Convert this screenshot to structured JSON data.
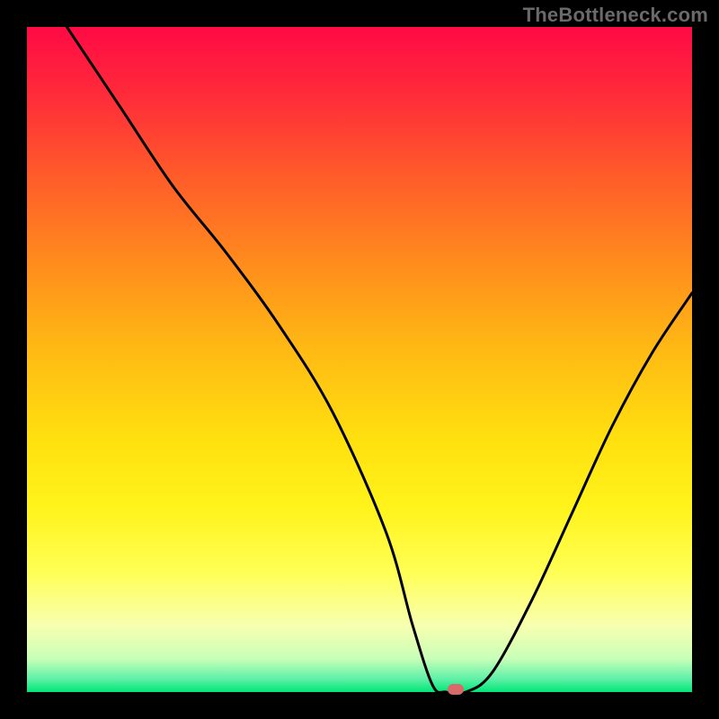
{
  "attribution": "TheBottleneck.com",
  "chart_data": {
    "type": "line",
    "title": "",
    "xlabel": "",
    "ylabel": "",
    "xlim": [
      0,
      100
    ],
    "ylim": [
      0,
      100
    ],
    "series": [
      {
        "name": "curve",
        "x": [
          6,
          14,
          22,
          30,
          38,
          46,
          54,
          58,
          61,
          63,
          66,
          70,
          76,
          82,
          88,
          94,
          100
        ],
        "y": [
          100,
          88,
          76,
          66,
          55,
          42,
          24,
          10,
          1,
          0,
          0,
          3,
          14,
          27,
          40,
          51,
          60
        ]
      }
    ],
    "marker": {
      "x": 64.5,
      "y": 0
    },
    "colors": {
      "curve": "#000000",
      "marker": "#d86a6a",
      "frame": "#000000",
      "gradient_top": "#ff0a45",
      "gradient_bottom": "#00e676"
    }
  }
}
